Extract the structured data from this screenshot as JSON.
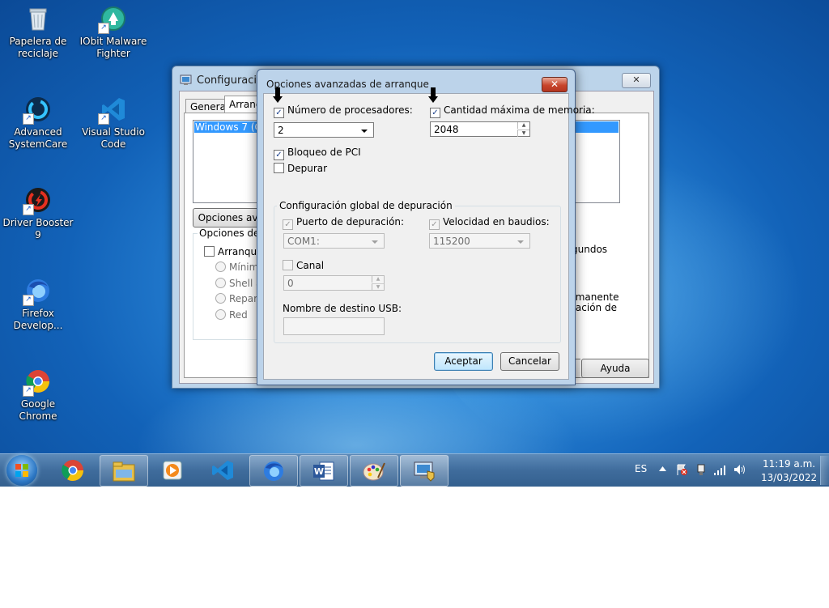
{
  "desktop": {
    "icons": [
      {
        "label": "Papelera de reciclaje",
        "icon": "recycle-bin-icon"
      },
      {
        "label": "IObit Malware Fighter",
        "icon": "iobit-malware-fighter-icon"
      },
      {
        "label": "Advanced SystemCare",
        "icon": "advanced-systemcare-icon"
      },
      {
        "label": "Visual Studio Code",
        "icon": "vscode-icon"
      },
      {
        "label": "Driver Booster 9",
        "icon": "driver-booster-icon"
      },
      {
        "label": "Firefox Develop...",
        "icon": "firefox-developer-icon"
      },
      {
        "label": "Google Chrome",
        "icon": "chrome-icon"
      }
    ]
  },
  "back_window": {
    "title": "Configuración",
    "tabs": [
      "General",
      "Arranque"
    ],
    "os_entry": "Windows 7 (C:",
    "advanced_button": "Opciones avan",
    "options_group_label": "Opciones de a",
    "safe_boot_label": "Arranque",
    "radio_options": [
      "Mínimo",
      "Shell a",
      "Repar",
      "Red"
    ],
    "right_text_1": "gundos",
    "right_text_2": "rmanente",
    "right_text_3": "ración de",
    "help_button": "Ayuda",
    "close_label": "✕"
  },
  "dialog": {
    "title": "Opciones avanzadas de arranque",
    "close_label": "✕",
    "num_processors": {
      "label": "Número de procesadores:",
      "checked": true,
      "value": "2"
    },
    "max_memory": {
      "label": "Cantidad máxima de memoria:",
      "checked": true,
      "value": "2048"
    },
    "pci_lock": {
      "label": "Bloqueo de PCI",
      "checked": true
    },
    "debug": {
      "label": "Depurar",
      "checked": false
    },
    "debug_group": {
      "title": "Configuración global de depuración",
      "debug_port": {
        "label": "Puerto de depuración:",
        "checked": true,
        "value": "COM1:"
      },
      "baud_rate": {
        "label": "Velocidad en baudios:",
        "checked": true,
        "value": "115200"
      },
      "channel": {
        "label": "Canal",
        "checked": false,
        "value": "0"
      },
      "usb_target": {
        "label": "Nombre de destino USB:",
        "value": ""
      }
    },
    "ok_button": "Aceptar",
    "cancel_button": "Cancelar"
  },
  "taskbar": {
    "pinned": [
      "chrome-icon",
      "file-explorer-icon",
      "media-player-icon",
      "vscode-icon",
      "firefox-icon",
      "word-icon",
      "paint-icon",
      "system-config-icon"
    ],
    "language": "ES",
    "time": "11:19 a.m.",
    "date": "13/03/2022"
  }
}
